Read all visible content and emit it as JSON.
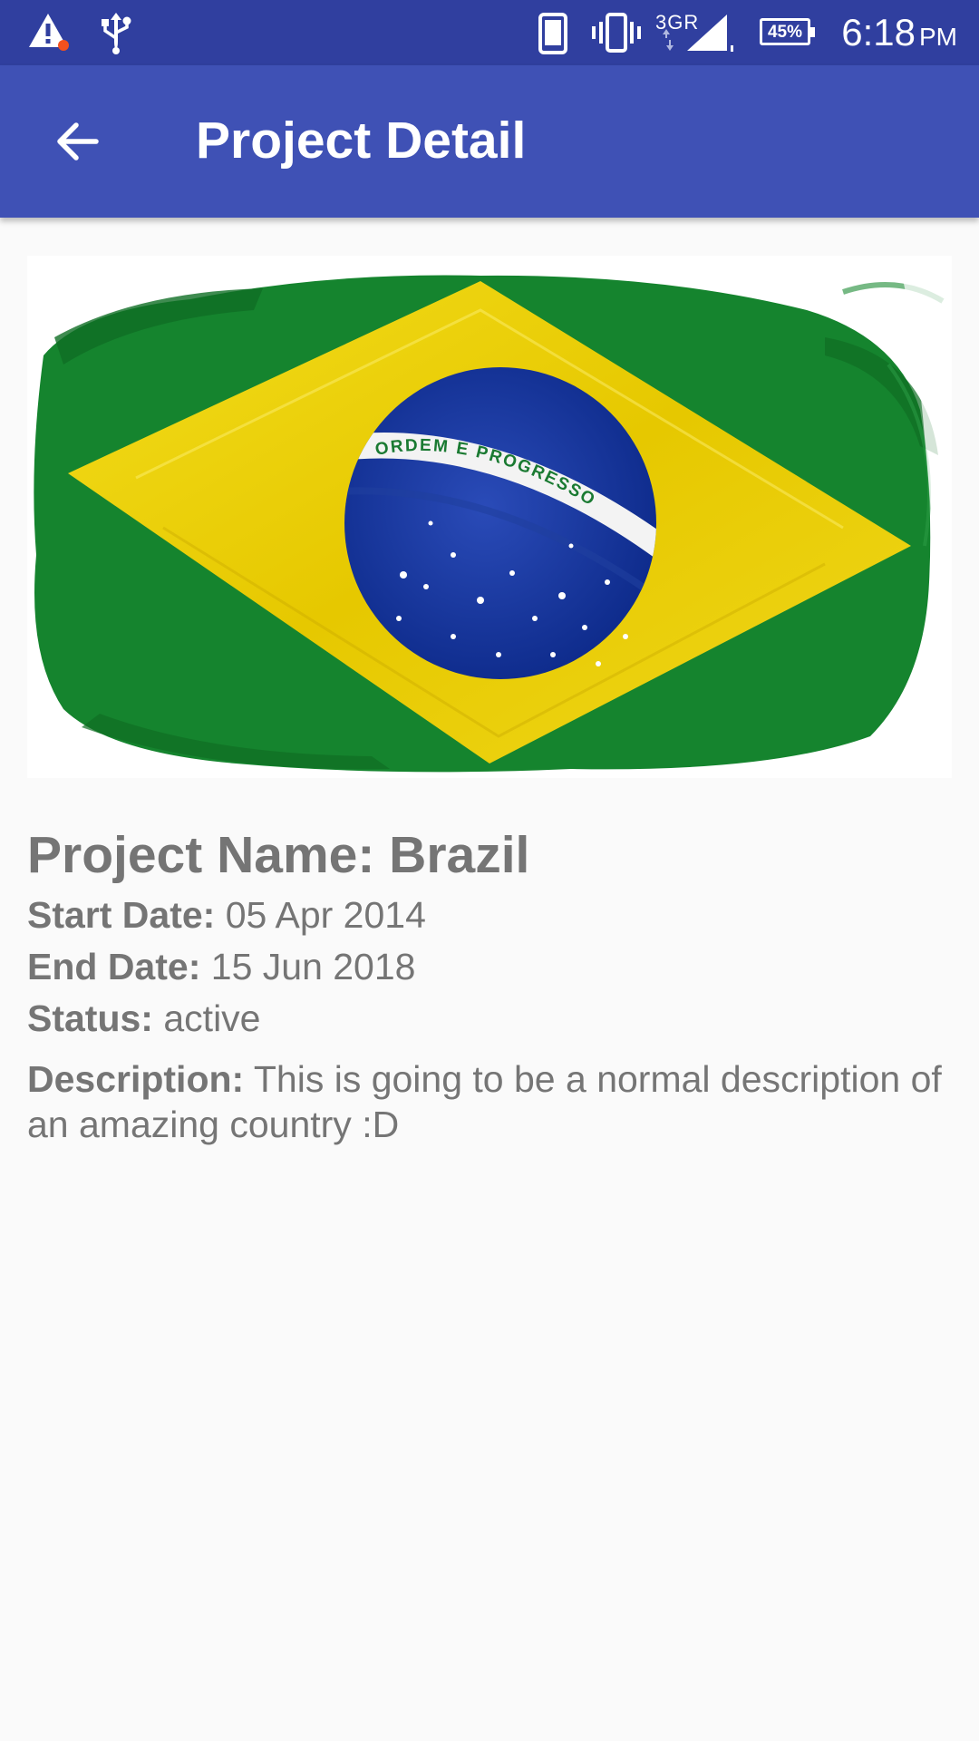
{
  "status_bar": {
    "network_label": "3GR",
    "battery_percent": "45%",
    "time": "6:18",
    "ampm": "PM",
    "icons": [
      "warning-icon",
      "usb-icon",
      "phone-icon",
      "vibrate-icon",
      "signal-icon",
      "battery-icon"
    ],
    "notification_dot_color": "#f4511e"
  },
  "app_bar": {
    "title": "Project Detail",
    "back_icon": "arrow-back-icon",
    "color": "#3f51b5"
  },
  "hero": {
    "image": "brazil-flag",
    "banner_text": "ORDEM E PROGRESSO"
  },
  "project": {
    "name_label": "Project Name:",
    "name_value": "Brazil",
    "start_label": "Start Date:",
    "start_value": "05 Apr 2014",
    "end_label": "End Date:",
    "end_value": "15 Jun 2018",
    "status_label": "Status:",
    "status_value": "active",
    "description_label": "Description:",
    "description_value": "This is going to be a normal description of an amazing country :D"
  }
}
